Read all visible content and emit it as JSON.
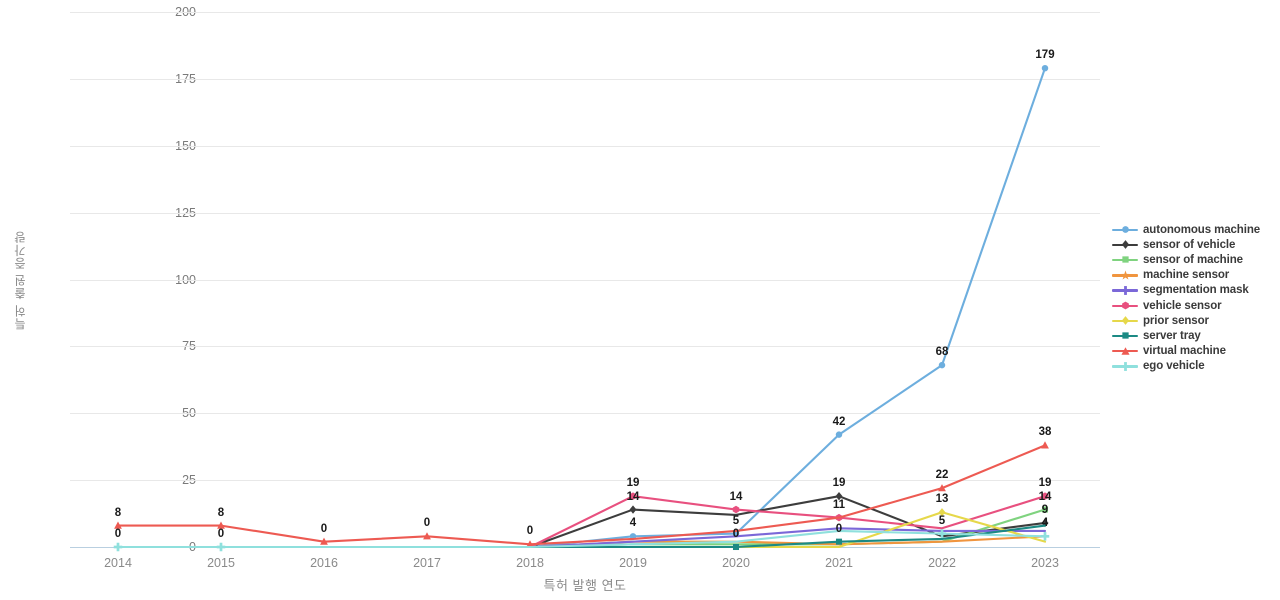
{
  "chart_data": {
    "type": "line",
    "title": "",
    "xlabel": "특허 발행 연도",
    "ylabel": "특허 출원 증가량",
    "categories": [
      "2014",
      "2015",
      "2016",
      "2017",
      "2018",
      "2019",
      "2020",
      "2021",
      "2022",
      "2023"
    ],
    "x": [
      2014,
      2015,
      2016,
      2017,
      2018,
      2019,
      2020,
      2021,
      2022,
      2023
    ],
    "ylim": [
      0,
      200
    ],
    "yticks": [
      0,
      25,
      50,
      75,
      100,
      125,
      150,
      175,
      200
    ],
    "grid": true,
    "legend_position": "right",
    "series": [
      {
        "name": "autonomous machine",
        "color": "#6daede",
        "marker": "circle",
        "values": [
          0,
          0,
          0,
          0,
          0,
          4,
          5,
          42,
          68,
          179
        ],
        "labels": [
          "",
          "",
          "",
          "",
          "",
          "4",
          "5",
          "42",
          "68",
          "179"
        ]
      },
      {
        "name": "sensor of vehicle",
        "color": "#3d3d3d",
        "marker": "diamond",
        "values": [
          0,
          0,
          0,
          0,
          0,
          14,
          12,
          19,
          4,
          9
        ],
        "labels": [
          "",
          "",
          "",
          "",
          "",
          "14",
          "",
          "19",
          "",
          "9"
        ]
      },
      {
        "name": "sensor of machine",
        "color": "#7fd37f",
        "marker": "square",
        "values": [
          0,
          0,
          0,
          0,
          0,
          1,
          1,
          1,
          2,
          14
        ],
        "labels": [
          "",
          "",
          "",
          "",
          "",
          "",
          "",
          "",
          "",
          "14"
        ]
      },
      {
        "name": "machine sensor",
        "color": "#f0953f",
        "marker": "star",
        "values": [
          0,
          0,
          0,
          0,
          0,
          2,
          2,
          1,
          2,
          4
        ],
        "labels": [
          "",
          "",
          "",
          "",
          "",
          "",
          "",
          "",
          "",
          ""
        ]
      },
      {
        "name": "segmentation mask",
        "color": "#7b68d8",
        "marker": "plus",
        "values": [
          0,
          0,
          0,
          0,
          0,
          2,
          4,
          7,
          6,
          6
        ],
        "labels": [
          "",
          "",
          "",
          "",
          "",
          "",
          "",
          "",
          "",
          ""
        ]
      },
      {
        "name": "vehicle sensor",
        "color": "#e8507f",
        "marker": "hexagon",
        "values": [
          0,
          0,
          0,
          0,
          0,
          19,
          14,
          11,
          7,
          19
        ],
        "labels": [
          "",
          "",
          "",
          "",
          "",
          "19",
          "14",
          "11",
          "",
          "19"
        ]
      },
      {
        "name": "prior sensor",
        "color": "#e6d84a",
        "marker": "diamond",
        "values": [
          0,
          0,
          0,
          0,
          0,
          0,
          0,
          0,
          13,
          2
        ],
        "labels": [
          "",
          "",
          "",
          "",
          "",
          "",
          "",
          "",
          "13",
          ""
        ]
      },
      {
        "name": "server tray",
        "color": "#1c8a84",
        "marker": "square",
        "values": [
          0,
          0,
          0,
          0,
          0,
          0,
          0,
          2,
          3,
          8
        ],
        "labels": [
          "",
          "",
          "",
          "",
          "",
          "",
          "0",
          "0",
          "",
          ""
        ]
      },
      {
        "name": "virtual machine",
        "color": "#ed5a52",
        "marker": "triangle",
        "values": [
          8,
          8,
          2,
          4,
          1,
          3,
          6,
          11,
          22,
          38
        ],
        "labels": [
          "8",
          "8",
          "0",
          "0",
          "0",
          "",
          "",
          "",
          "22",
          "38"
        ]
      },
      {
        "name": "ego vehicle",
        "color": "#8fe0dd",
        "marker": "plus",
        "values": [
          0,
          0,
          0,
          0,
          0,
          1,
          2,
          6,
          5,
          4
        ],
        "labels": [
          "0",
          "0",
          "",
          "",
          "",
          "",
          "",
          "",
          "5",
          "4"
        ]
      }
    ]
  }
}
